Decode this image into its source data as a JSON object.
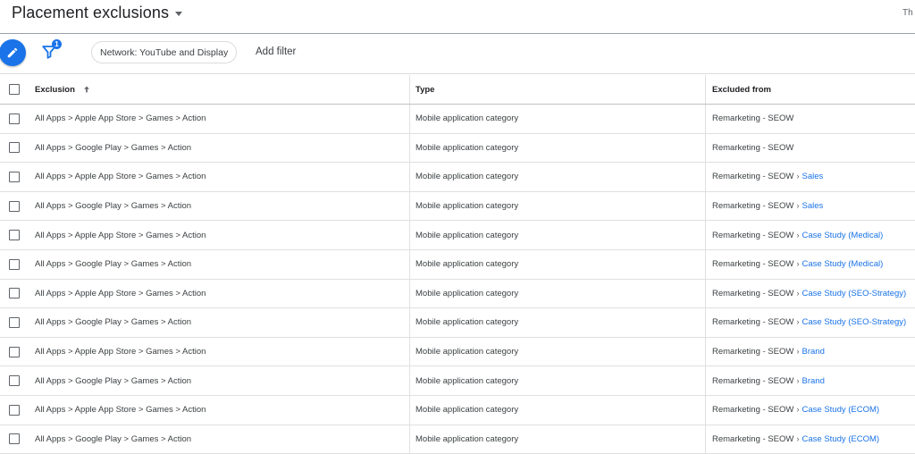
{
  "header": {
    "title": "Placement exclusions",
    "right_text": "Th"
  },
  "toolbar": {
    "filter_badge": "1",
    "network_chip": "Network: YouTube and Display",
    "add_filter": "Add filter"
  },
  "table": {
    "columns": [
      "Exclusion",
      "Type",
      "Excluded from"
    ],
    "rows": [
      {
        "exclusion": "All Apps > Apple App Store > Games > Action",
        "type": "Mobile application category",
        "campaign": "Remarketing - SEOW",
        "ad_group": ""
      },
      {
        "exclusion": "All Apps > Google Play > Games > Action",
        "type": "Mobile application category",
        "campaign": "Remarketing - SEOW",
        "ad_group": ""
      },
      {
        "exclusion": "All Apps > Apple App Store > Games > Action",
        "type": "Mobile application category",
        "campaign": "Remarketing - SEOW",
        "ad_group": "Sales"
      },
      {
        "exclusion": "All Apps > Google Play > Games > Action",
        "type": "Mobile application category",
        "campaign": "Remarketing - SEOW",
        "ad_group": "Sales"
      },
      {
        "exclusion": "All Apps > Apple App Store > Games > Action",
        "type": "Mobile application category",
        "campaign": "Remarketing - SEOW",
        "ad_group": "Case Study (Medical)"
      },
      {
        "exclusion": "All Apps > Google Play > Games > Action",
        "type": "Mobile application category",
        "campaign": "Remarketing - SEOW",
        "ad_group": "Case Study (Medical)"
      },
      {
        "exclusion": "All Apps > Apple App Store > Games > Action",
        "type": "Mobile application category",
        "campaign": "Remarketing - SEOW",
        "ad_group": "Case Study (SEO-Strategy)"
      },
      {
        "exclusion": "All Apps > Google Play > Games > Action",
        "type": "Mobile application category",
        "campaign": "Remarketing - SEOW",
        "ad_group": "Case Study (SEO-Strategy)"
      },
      {
        "exclusion": "All Apps > Apple App Store > Games > Action",
        "type": "Mobile application category",
        "campaign": "Remarketing - SEOW",
        "ad_group": "Brand"
      },
      {
        "exclusion": "All Apps > Google Play > Games > Action",
        "type": "Mobile application category",
        "campaign": "Remarketing - SEOW",
        "ad_group": "Brand"
      },
      {
        "exclusion": "All Apps > Apple App Store > Games > Action",
        "type": "Mobile application category",
        "campaign": "Remarketing - SEOW",
        "ad_group": "Case Study (ECOM)"
      },
      {
        "exclusion": "All Apps > Google Play > Games > Action",
        "type": "Mobile application category",
        "campaign": "Remarketing - SEOW",
        "ad_group": "Case Study (ECOM)"
      }
    ]
  },
  "icons": {
    "fab": "pencil-icon",
    "filter": "filter-icon",
    "sort": "arrow-up-icon"
  },
  "colors": {
    "accent": "#1a73e8"
  }
}
